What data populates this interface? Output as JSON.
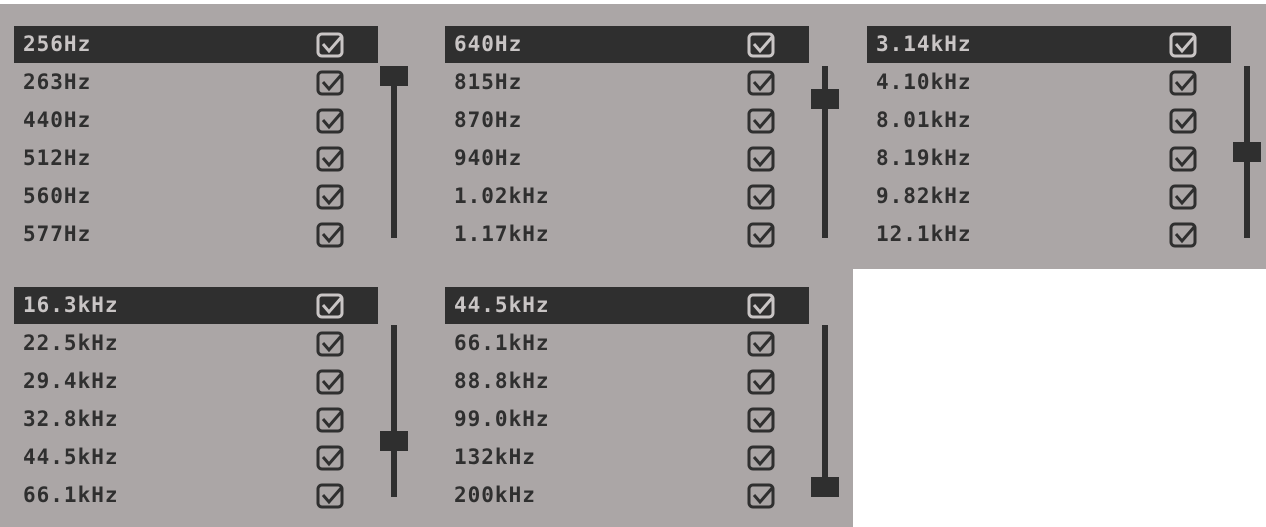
{
  "panels": [
    {
      "items": [
        {
          "label": "256Hz",
          "checked": true,
          "selected": true
        },
        {
          "label": "263Hz",
          "checked": true,
          "selected": false
        },
        {
          "label": "440Hz",
          "checked": true,
          "selected": false
        },
        {
          "label": "512Hz",
          "checked": true,
          "selected": false
        },
        {
          "label": "560Hz",
          "checked": true,
          "selected": false
        },
        {
          "label": "577Hz",
          "checked": true,
          "selected": false
        }
      ],
      "scroll_position": 0.0
    },
    {
      "items": [
        {
          "label": "640Hz",
          "checked": true,
          "selected": true
        },
        {
          "label": "815Hz",
          "checked": true,
          "selected": false
        },
        {
          "label": "870Hz",
          "checked": true,
          "selected": false
        },
        {
          "label": "940Hz",
          "checked": true,
          "selected": false
        },
        {
          "label": "1.02kHz",
          "checked": true,
          "selected": false
        },
        {
          "label": "1.17kHz",
          "checked": true,
          "selected": false
        }
      ],
      "scroll_position": 0.15
    },
    {
      "items": [
        {
          "label": "3.14kHz",
          "checked": true,
          "selected": true
        },
        {
          "label": "4.10kHz",
          "checked": true,
          "selected": false
        },
        {
          "label": "8.01kHz",
          "checked": true,
          "selected": false
        },
        {
          "label": "8.19kHz",
          "checked": true,
          "selected": false
        },
        {
          "label": "9.82kHz",
          "checked": true,
          "selected": false
        },
        {
          "label": "12.1kHz",
          "checked": true,
          "selected": false
        }
      ],
      "scroll_position": 0.5
    },
    {
      "items": [
        {
          "label": "16.3kHz",
          "checked": true,
          "selected": true
        },
        {
          "label": "22.5kHz",
          "checked": true,
          "selected": false
        },
        {
          "label": "29.4kHz",
          "checked": true,
          "selected": false
        },
        {
          "label": "32.8kHz",
          "checked": true,
          "selected": false
        },
        {
          "label": "44.5kHz",
          "checked": true,
          "selected": false
        },
        {
          "label": "66.1kHz",
          "checked": true,
          "selected": false
        }
      ],
      "scroll_position": 0.7
    },
    {
      "items": [
        {
          "label": "44.5kHz",
          "checked": true,
          "selected": true
        },
        {
          "label": "66.1kHz",
          "checked": true,
          "selected": false
        },
        {
          "label": "88.8kHz",
          "checked": true,
          "selected": false
        },
        {
          "label": "99.0kHz",
          "checked": true,
          "selected": false
        },
        {
          "label": "132kHz",
          "checked": true,
          "selected": false
        },
        {
          "label": "200kHz",
          "checked": true,
          "selected": false
        }
      ],
      "scroll_position": 1.0
    }
  ],
  "colors": {
    "panel_bg": "#aba6a6",
    "dark": "#2f2f2f",
    "selected_text": "#c9c5c5"
  },
  "icons": {
    "check": "checkbox-checked-icon"
  }
}
